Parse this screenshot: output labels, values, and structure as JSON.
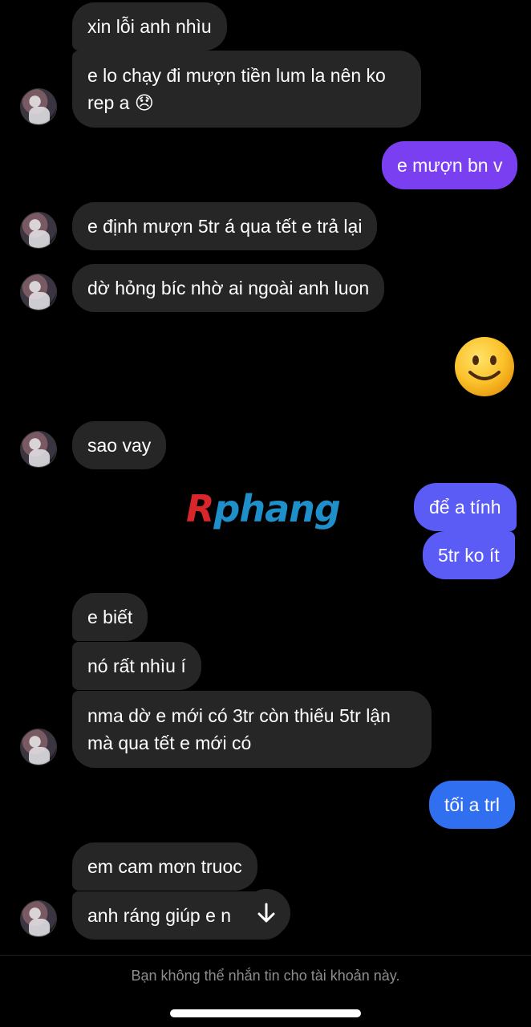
{
  "messages": [
    {
      "text": "xin lỗi anh nhìu"
    },
    {
      "line1": "e lo chạy đi mượn tiền lum la nên ko",
      "line2": "rep a 😞"
    },
    {
      "text": "e mượn bn v"
    },
    {
      "text": "e định mượn 5tr á qua tết e trả lại"
    },
    {
      "text": "dờ hỏng bíc nhờ ai ngoài anh luon"
    },
    {
      "emoji": "slightly-smiling-face"
    },
    {
      "text": "sao vay"
    },
    {
      "text": "để a tính"
    },
    {
      "text": "5tr ko ít"
    },
    {
      "text": "e biết"
    },
    {
      "text": "nó rất nhìu í"
    },
    {
      "line1": "nma dờ e mới có 3tr còn thiếu 5tr lận",
      "line2": "mà qua tết e mới có"
    },
    {
      "text": "tối a trl"
    },
    {
      "text": "em cam mơn truoc"
    },
    {
      "text": "anh ráng giúp e n"
    }
  ],
  "watermark": {
    "part1": "R",
    "part2": "phang"
  },
  "footer": {
    "notice": "Bạn không thể nhắn tin cho tài khoản này."
  },
  "icons": {
    "emoji": "slightly-smiling-face-icon",
    "scroll": "arrow-down-icon",
    "avatar": "avatar"
  },
  "colors": {
    "background": "#000000",
    "received_bubble": "#262626",
    "sent_purple": "#7b3ff2",
    "sent_violet": "#5b5bf5",
    "sent_blue": "#2f6ff0"
  }
}
